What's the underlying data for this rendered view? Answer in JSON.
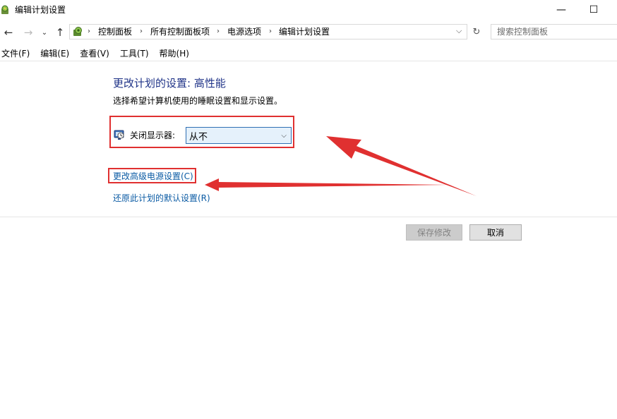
{
  "window": {
    "title": "编辑计划设置",
    "icon": "power-options-icon",
    "minimize_glyph": "—",
    "maximize_glyph": "☐"
  },
  "nav": {
    "back_glyph": "←",
    "forward_glyph": "→",
    "recent_glyph": "⌄",
    "up_glyph": "↑",
    "refresh_glyph": "↻",
    "dropdown_glyph": "⌵"
  },
  "address": {
    "separator": "›",
    "crumbs": [
      "控制面板",
      "所有控制面板项",
      "电源选项",
      "编辑计划设置"
    ]
  },
  "search": {
    "placeholder": "搜索控制面板"
  },
  "menu": {
    "items": [
      "文件(F)",
      "编辑(E)",
      "查看(V)",
      "工具(T)",
      "帮助(H)"
    ]
  },
  "content": {
    "heading": "更改计划的设置: 高性能",
    "subtext": "选择希望计算机使用的睡眠设置和显示设置。",
    "display_off_label": "关闭显示器:",
    "display_off_value": "从不",
    "advanced_link": "更改高级电源设置(C)",
    "restore_link": "还原此计划的默认设置(R)"
  },
  "buttons": {
    "save": "保存修改",
    "cancel": "取消"
  },
  "annotation": {
    "color": "#e03030"
  }
}
